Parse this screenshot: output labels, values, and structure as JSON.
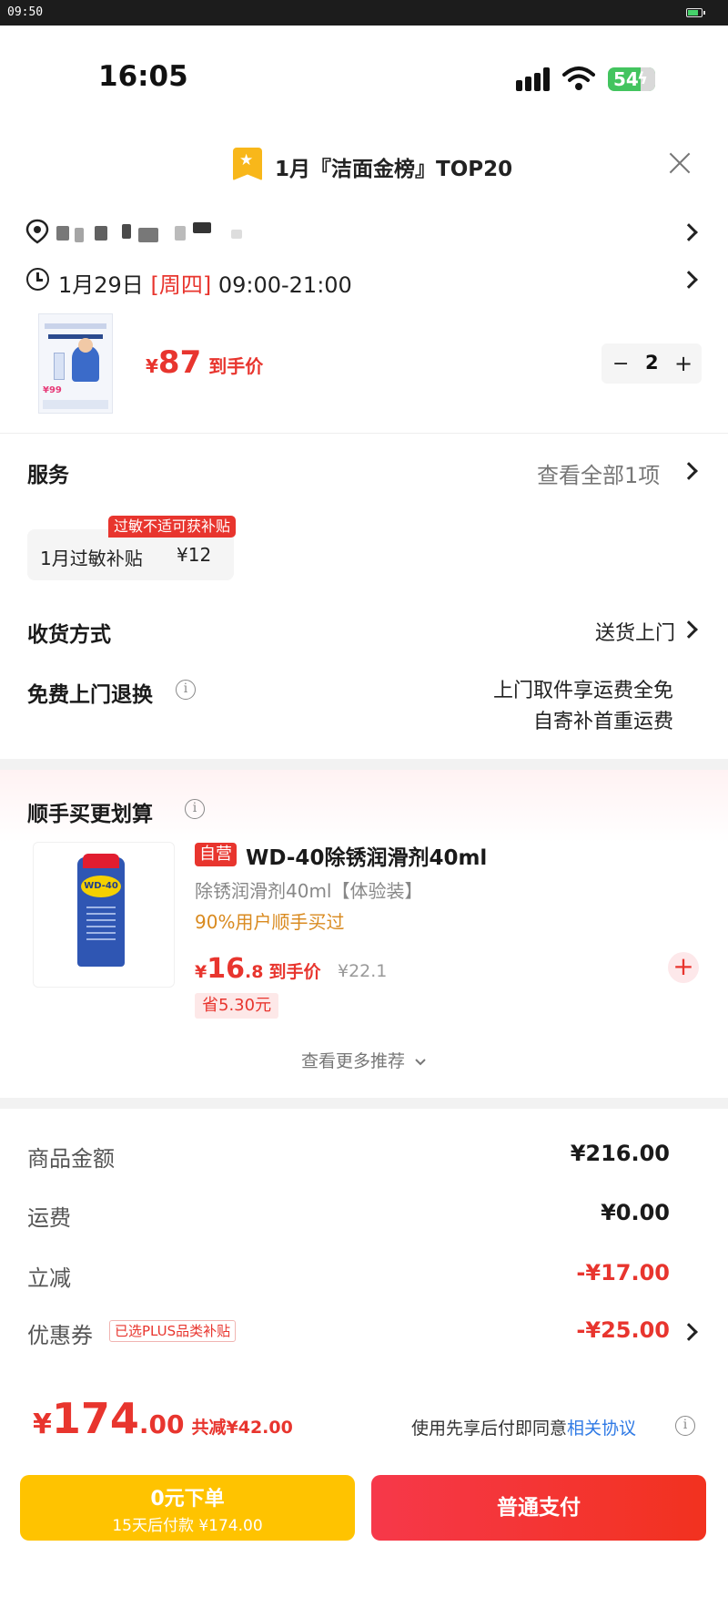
{
  "system_bar": {
    "time": "09:50"
  },
  "phone_status": {
    "time": "16:05",
    "battery": "54"
  },
  "banner": {
    "text": "1月『洁面金榜』TOP20"
  },
  "delivery": {
    "date": "1月29日",
    "weekday": "[周四]",
    "hours": "09:00-21:00"
  },
  "product": {
    "thumb_promo": "¥99",
    "price_symbol": "¥",
    "price": "87",
    "price_label": "到手价",
    "qty_minus": "−",
    "quantity": "2",
    "qty_plus": "+"
  },
  "service": {
    "title": "服务",
    "view_all": "查看全部1项",
    "chip_tag": "过敏不适可获补贴",
    "chip_name": "1月过敏补贴",
    "chip_amount": "¥12"
  },
  "shipping": {
    "label": "收货方式",
    "value": "送货上门"
  },
  "free_return": {
    "label": "免费上门退换",
    "line1": "上门取件享运费全免",
    "line2": "自寄补首重运费"
  },
  "recommend": {
    "title": "顺手买更划算",
    "item": {
      "self_tag": "自营",
      "can_logo": "WD-40",
      "title": "WD-40除锈润滑剂40ml",
      "subtitle": "除锈润滑剂40ml【体验装】",
      "popularity": "90%用户顺手买过",
      "price_symbol": "¥",
      "price_int": "16",
      "price_dec": ".8",
      "price_label": "到手价",
      "original_price": "¥22.1",
      "save": "省5.30元",
      "add": "+"
    },
    "more": "查看更多推荐"
  },
  "summary": {
    "goods_label": "商品金额",
    "goods_value": "¥216.00",
    "freight_label": "运费",
    "freight_value": "¥0.00",
    "discount_label": "立减",
    "discount_value": "-¥17.00",
    "coupon_label": "优惠券",
    "coupon_tag": "已选PLUS品类补贴",
    "coupon_value": "-¥25.00"
  },
  "total": {
    "symbol": "¥",
    "int": "174",
    "dec": ".00",
    "saved": "共减¥42.00",
    "agree_text": "使用先享后付即同意",
    "agree_link": "相关协议"
  },
  "buttons": {
    "zero_title": "0元下单",
    "zero_sub": "15天后付款 ¥174.00",
    "pay": "普通支付"
  },
  "colors": {
    "accent_red": "#e8352e",
    "yellow": "#ffc300",
    "link_blue": "#2f7ae5"
  }
}
